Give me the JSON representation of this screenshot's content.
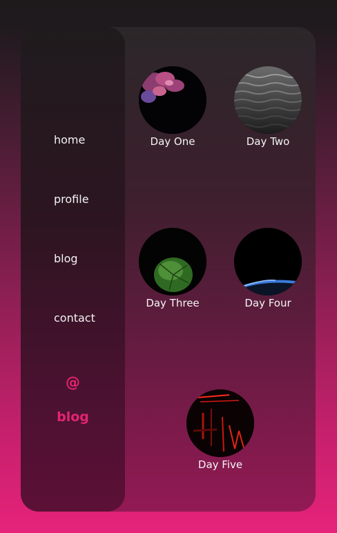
{
  "nav": {
    "items": [
      {
        "label": "home"
      },
      {
        "label": "profile"
      },
      {
        "label": "blog"
      },
      {
        "label": "contact"
      }
    ],
    "at_symbol": "@",
    "brand": "blog",
    "accent_color": "#e4246f"
  },
  "posts": [
    {
      "title": "Day One",
      "image": "smoke-cloud"
    },
    {
      "title": "Day Two",
      "image": "water-ripples"
    },
    {
      "title": "Day Three",
      "image": "green-leaf"
    },
    {
      "title": "Day Four",
      "image": "planet-horizon"
    },
    {
      "title": "Day Five",
      "image": "red-neon-lights"
    }
  ]
}
